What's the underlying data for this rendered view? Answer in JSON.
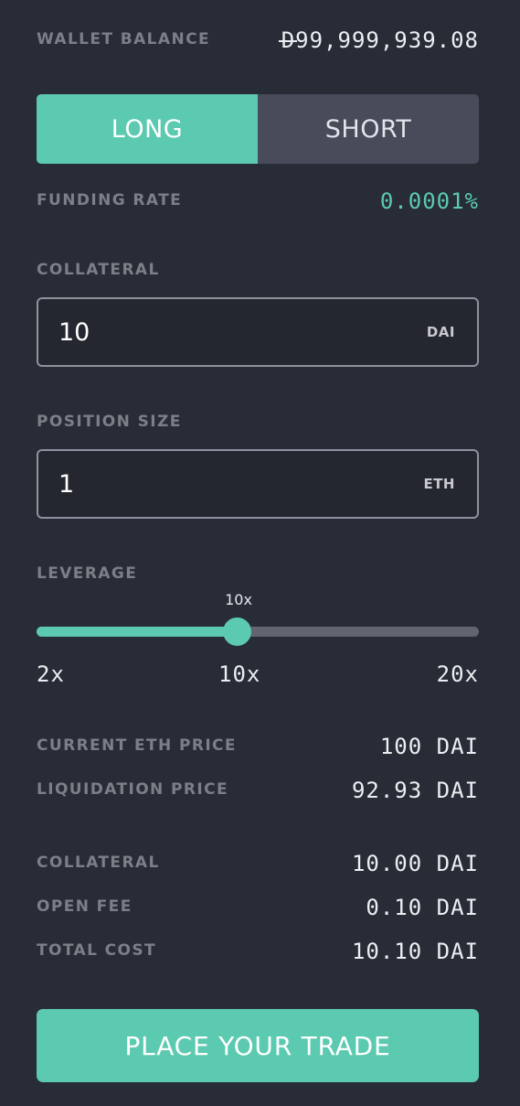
{
  "wallet": {
    "label": "WALLET BALANCE",
    "currency_symbol": "D",
    "balance": "99,999,939.08"
  },
  "side_toggle": {
    "long_label": "LONG",
    "short_label": "SHORT",
    "selected": "LONG"
  },
  "funding": {
    "label": "FUNDING RATE",
    "value": "0.0001%",
    "color": "#5ccab0"
  },
  "collateral_input": {
    "label": "COLLATERAL",
    "value": "10",
    "unit": "DAI"
  },
  "position_input": {
    "label": "POSITION SIZE",
    "value": "1",
    "unit": "ETH"
  },
  "leverage": {
    "label": "LEVERAGE",
    "current_label": "10x",
    "current": 10,
    "min": 2,
    "max": 20,
    "ticks": [
      "2x",
      "10x",
      "20x"
    ]
  },
  "summary": {
    "current_price_label": "CURRENT ETH PRICE",
    "current_price_value": "100 DAI",
    "liquidation_label": "LIQUIDATION PRICE",
    "liquidation_value": "92.93 DAI",
    "collateral_label": "COLLATERAL",
    "collateral_value": "10.00 DAI",
    "open_fee_label": "OPEN FEE",
    "open_fee_value": "0.10 DAI",
    "total_cost_label": "TOTAL COST",
    "total_cost_value": "10.10 DAI"
  },
  "submit": {
    "label": "PLACE YOUR TRADE"
  },
  "colors": {
    "accent": "#5ccab0",
    "background": "#282c37",
    "short_bg": "#474b5a",
    "muted": "#7b7f88"
  },
  "icons": {
    "currency": "dai-currency-icon"
  }
}
